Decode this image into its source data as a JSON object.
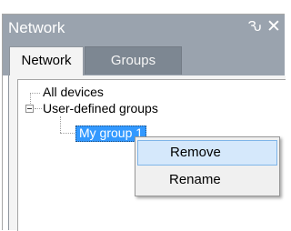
{
  "panel": {
    "title": "Network",
    "pin_icon": "pin-icon",
    "close_icon": "close-icon",
    "pin_glyph": "Ԅ",
    "close_glyph": "✕",
    "colors": {
      "titlebar": "#9aa3ae",
      "selection": "#3399ff",
      "menu_hover": "#d5e8fb"
    }
  },
  "tabs": [
    {
      "label": "Network",
      "active": true
    },
    {
      "label": "Groups",
      "active": false
    }
  ],
  "tree": {
    "nodes": [
      {
        "label": "All devices"
      },
      {
        "label": "User-defined groups",
        "expanded": true
      },
      {
        "label": "My group 1",
        "selected": true
      }
    ]
  },
  "context_menu": {
    "items": [
      {
        "label": "Remove",
        "highlighted": true
      },
      {
        "label": "Rename",
        "highlighted": false
      }
    ]
  }
}
